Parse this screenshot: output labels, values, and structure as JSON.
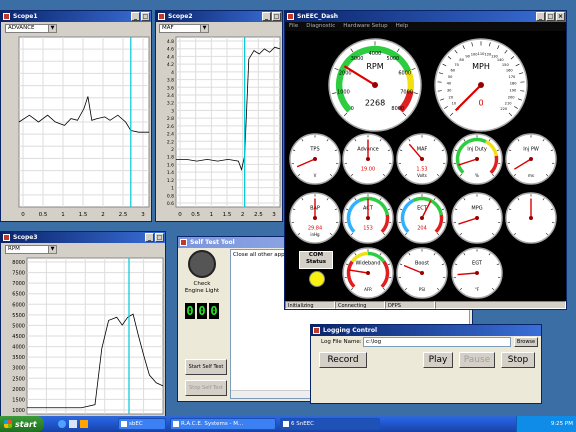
{
  "scope1": {
    "title": "Scope1",
    "channel": "ADVANCE",
    "x_ticks": [
      "0",
      "0.5",
      "1",
      "1.5",
      "2",
      "2.5",
      "3"
    ],
    "y_ticks": []
  },
  "scope2": {
    "title": "Scope2",
    "channel": "MAF",
    "x_ticks": [
      "0",
      "0.5",
      "1",
      "1.5",
      "2",
      "2.5",
      "3"
    ],
    "y_ticks": [
      "4.8",
      "4.6",
      "4.4",
      "4.2",
      "4",
      "3.8",
      "3.6",
      "3.4",
      "3.2",
      "3",
      "2.8",
      "2.6",
      "2.4",
      "2.2",
      "2",
      "1.8",
      "1.6",
      "1.4",
      "1.2",
      "1",
      "0.8",
      "0.6"
    ]
  },
  "scope3": {
    "title": "Scope3",
    "channel": "RPM",
    "y_ticks": [
      "8000",
      "7500",
      "7000",
      "6500",
      "6000",
      "5500",
      "5000",
      "4500",
      "4000",
      "3500",
      "3000",
      "2500",
      "2000",
      "1500",
      "1000"
    ]
  },
  "dash": {
    "title": "SnEEC_Dash",
    "menu": [
      "File",
      "Diagnostic",
      "Hardware Setup",
      "Help"
    ],
    "rpm": {
      "label": "RPM",
      "value": "2268",
      "ticks": [
        "0",
        "1000",
        "2000",
        "3000",
        "4000",
        "5000",
        "6000",
        "7000",
        "8000"
      ]
    },
    "mph": {
      "label": "MPH",
      "value": "0",
      "ticks": [
        "0",
        "10",
        "20",
        "30",
        "40",
        "50",
        "60",
        "70",
        "80",
        "90",
        "100",
        "110",
        "120",
        "130",
        "140",
        "150",
        "160",
        "170",
        "180",
        "190",
        "200",
        "210",
        "220"
      ]
    },
    "small_gauges": [
      {
        "label": "TPS",
        "sub": "V",
        "value": ""
      },
      {
        "label": "Advance",
        "sub": "",
        "value": "19.00"
      },
      {
        "label": "MAF",
        "sub": "Volts",
        "value": "1.53"
      },
      {
        "label": "Inj Duty",
        "sub": "%",
        "value": ""
      },
      {
        "label": "Inj PW",
        "sub": "ms",
        "value": ""
      },
      {
        "label": "BAP",
        "sub": "inHg",
        "value": "29.84"
      },
      {
        "label": "ACT",
        "sub": "",
        "value": "153"
      },
      {
        "label": "ECT",
        "sub": "",
        "value": "204"
      },
      {
        "label": "MPG",
        "sub": "",
        "value": ""
      },
      {
        "label": "",
        "sub": "",
        "value": ""
      },
      {
        "label": "Wideband",
        "sub": "AFR",
        "value": ""
      },
      {
        "label": "Boost",
        "sub": "PSI",
        "value": ""
      },
      {
        "label": "EGT",
        "sub": "°F",
        "value": ""
      }
    ],
    "com": "COM\nStatus",
    "status": [
      "Initializing",
      "Connecting",
      "DFPS",
      ""
    ]
  },
  "selftest": {
    "title": "Self Test Tool",
    "message": "Close all other applicat",
    "check_label": "Check Engine Light",
    "digits": [
      "0",
      "0",
      "0"
    ],
    "start_btn": "Start Self Test",
    "stop_btn": "Stop Self Test"
  },
  "logging": {
    "title": "Logging Control",
    "file_label": "Log File Name:",
    "file_value": "c:\\log",
    "browse": "Browse",
    "record": "Record",
    "play": "Play",
    "pause": "Pause",
    "stop": "Stop"
  },
  "taskbar": {
    "start": "start",
    "tasks": [
      "sbEC",
      "R.A.C.E. Systems - M...",
      "6 SnEEC"
    ],
    "clock": "9:25 PM"
  }
}
